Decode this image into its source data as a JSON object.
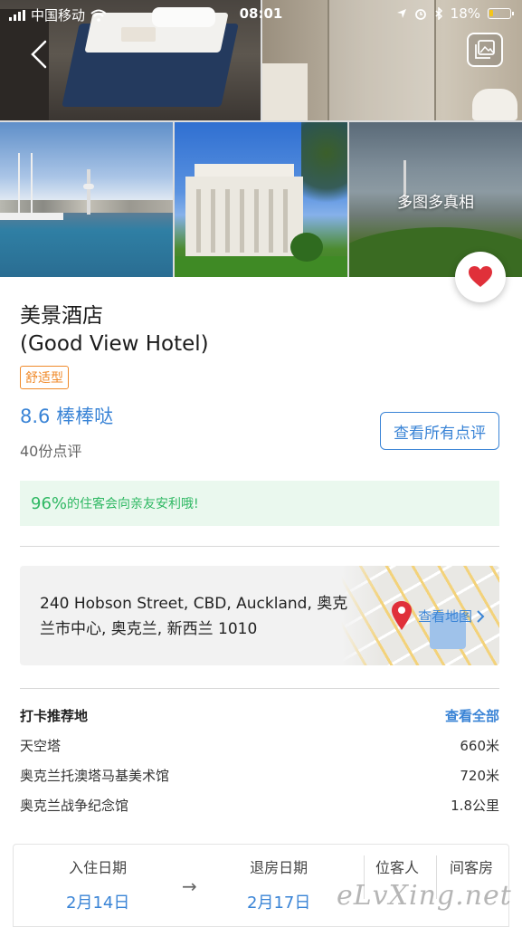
{
  "status_bar": {
    "carrier": "中国移动",
    "time": "08:01",
    "battery": "18%",
    "battery_level": 0.18
  },
  "gallery": {
    "overlay_label": "多图多真相"
  },
  "hotel": {
    "name_cn": "美景酒店",
    "name_en": "(Good View Hotel)",
    "type_badge": "舒适型",
    "rating": "8.6 棒棒哒",
    "review_count": "40份点评",
    "view_reviews_label": "查看所有点评",
    "recommend_percent": "96%",
    "recommend_text": "的住客会向亲友安利哦!"
  },
  "address": {
    "text": "240 Hobson Street, CBD, Auckland, 奥克兰市中心, 奥克兰, 新西兰 1010",
    "map_link": "查看地图"
  },
  "poi": {
    "title": "打卡推荐地",
    "view_all": "查看全部",
    "items": [
      {
        "name": "天空塔",
        "distance": "660米"
      },
      {
        "name": "奥克兰托澳塔马基美术馆",
        "distance": "720米"
      },
      {
        "name": "奥克兰战争纪念馆",
        "distance": "1.8公里"
      }
    ]
  },
  "booking": {
    "checkin_label": "入住日期",
    "checkin_date": "2月14日",
    "checkout_label": "退房日期",
    "checkout_date": "2月17日",
    "guests_label": "位客人",
    "rooms_label": "间客房"
  },
  "watermark": "eLvXing.net",
  "colors": {
    "accent_blue": "#3a84d6",
    "badge_orange": "#f08a2a",
    "recommend_green": "#2fb863",
    "heart_red": "#e0303a"
  }
}
